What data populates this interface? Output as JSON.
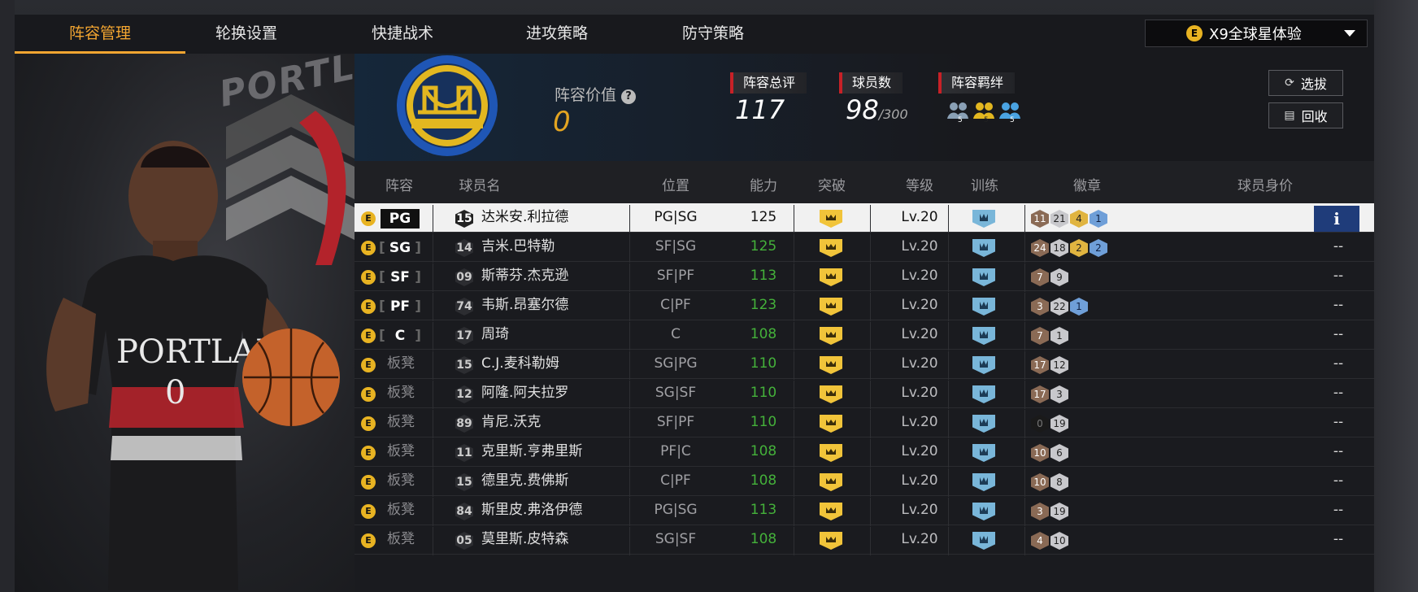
{
  "nav": {
    "tabs": [
      "阵容管理",
      "轮换设置",
      "快捷战术",
      "进攻策略",
      "防守策略"
    ],
    "active_tab": "阵容管理",
    "mode_icon": "E",
    "mode_select": "X9全球星体验"
  },
  "player_panel": {
    "jersey_team": "PORTLAND",
    "jersey_number": "0",
    "bg_text": "PORTLAN"
  },
  "header": {
    "value_label": "阵容价值",
    "help_icon": "?",
    "value": "0",
    "rating_label": "阵容总评",
    "rating": "117",
    "players_label": "球员数",
    "players_count": "98",
    "players_max": "/300",
    "bonds_label": "阵容羁绊",
    "bond_badges": [
      "5",
      "5",
      "5"
    ],
    "select_button": "选拔",
    "recycle_button": "回收"
  },
  "table": {
    "columns": [
      "阵容",
      "球员名",
      "位置",
      "能力",
      "突破",
      "等级",
      "训练",
      "徽章",
      "球员身价"
    ],
    "info_label": "i",
    "rows": [
      {
        "slot": "PG",
        "number": "15",
        "name": "达米安.利拉德",
        "pos": "PG|SG",
        "ability": "125",
        "level": "Lv.20",
        "badges": [
          [
            "11",
            "hof"
          ],
          [
            "21",
            "silver"
          ],
          [
            "4",
            "gold"
          ],
          [
            "1",
            "blue"
          ]
        ],
        "price": ""
      },
      {
        "slot": "SG",
        "number": "14",
        "name": "吉米.巴特勒",
        "pos": "SF|SG",
        "ability": "125",
        "level": "Lv.20",
        "badges": [
          [
            "24",
            "hof"
          ],
          [
            "18",
            "silver"
          ],
          [
            "2",
            "gold"
          ],
          [
            "2",
            "blue"
          ]
        ],
        "price": "--"
      },
      {
        "slot": "SF",
        "number": "09",
        "name": "斯蒂芬.杰克逊",
        "pos": "SF|PF",
        "ability": "113",
        "level": "Lv.20",
        "badges": [
          [
            "7",
            "hof"
          ],
          [
            "9",
            "silver"
          ]
        ],
        "price": "--"
      },
      {
        "slot": "PF",
        "number": "74",
        "name": "韦斯.昂塞尔德",
        "pos": "C|PF",
        "ability": "123",
        "level": "Lv.20",
        "badges": [
          [
            "3",
            "hof"
          ],
          [
            "22",
            "silver"
          ],
          [
            "1",
            "blue"
          ]
        ],
        "price": "--"
      },
      {
        "slot": "C",
        "number": "17",
        "name": "周琦",
        "pos": "C",
        "ability": "108",
        "level": "Lv.20",
        "badges": [
          [
            "7",
            "hof"
          ],
          [
            "1",
            "silver"
          ]
        ],
        "price": "--"
      },
      {
        "slot": "板凳",
        "number": "15",
        "name": "C.J.麦科勒姆",
        "pos": "SG|PG",
        "ability": "110",
        "level": "Lv.20",
        "badges": [
          [
            "17",
            "hof"
          ],
          [
            "12",
            "silver"
          ]
        ],
        "price": "--"
      },
      {
        "slot": "板凳",
        "number": "12",
        "name": "阿隆.阿夫拉罗",
        "pos": "SG|SF",
        "ability": "110",
        "level": "Lv.20",
        "badges": [
          [
            "17",
            "hof"
          ],
          [
            "3",
            "silver"
          ]
        ],
        "price": "--"
      },
      {
        "slot": "板凳",
        "number": "89",
        "name": "肯尼.沃克",
        "pos": "SF|PF",
        "ability": "110",
        "level": "Lv.20",
        "badges": [
          [
            "0",
            "bronze"
          ],
          [
            "19",
            "silver"
          ]
        ],
        "price": "--"
      },
      {
        "slot": "板凳",
        "number": "11",
        "name": "克里斯.亨弗里斯",
        "pos": "PF|C",
        "ability": "108",
        "level": "Lv.20",
        "badges": [
          [
            "10",
            "hof"
          ],
          [
            "6",
            "silver"
          ]
        ],
        "price": "--"
      },
      {
        "slot": "板凳",
        "number": "15",
        "name": "德里克.费佛斯",
        "pos": "C|PF",
        "ability": "108",
        "level": "Lv.20",
        "badges": [
          [
            "10",
            "hof"
          ],
          [
            "8",
            "silver"
          ]
        ],
        "price": "--"
      },
      {
        "slot": "板凳",
        "number": "84",
        "name": "斯里皮.弗洛伊德",
        "pos": "PG|SG",
        "ability": "113",
        "level": "Lv.20",
        "badges": [
          [
            "3",
            "hof"
          ],
          [
            "19",
            "silver"
          ]
        ],
        "price": "--"
      },
      {
        "slot": "板凳",
        "number": "05",
        "name": "莫里斯.皮特森",
        "pos": "SG|SF",
        "ability": "108",
        "level": "Lv.20",
        "badges": [
          [
            "4",
            "hof"
          ],
          [
            "10",
            "silver"
          ]
        ],
        "price": "--"
      }
    ]
  },
  "colors": {
    "accent": "#f2a531",
    "value": "#e3a421",
    "ability_green": "#44b13a",
    "stat_red": "#c82127"
  },
  "icons": {
    "mode": "e-coin-icon",
    "select": "refresh-icon",
    "recycle": "recycle-icon",
    "info": "info-icon"
  }
}
